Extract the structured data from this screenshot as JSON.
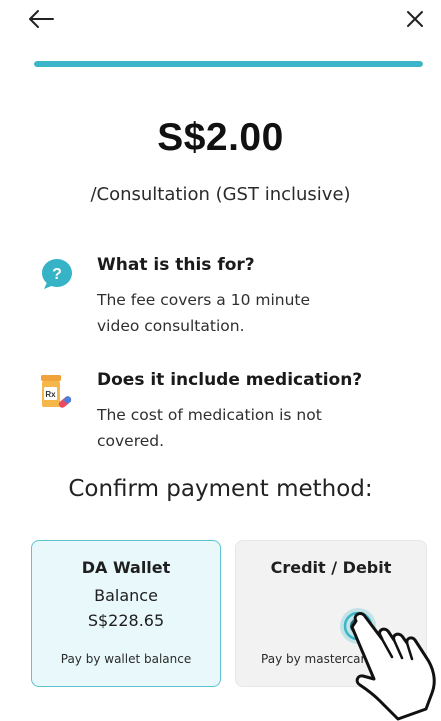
{
  "header": {
    "back_icon": "arrow-left-icon",
    "close_icon": "close-icon",
    "progress_percent": 100,
    "progress_color": "#3bb6c8"
  },
  "fee": {
    "price": "S$2.00",
    "subtitle": "/Consultation (GST inclusive)"
  },
  "info": [
    {
      "icon": "question-bubble-icon",
      "title": "What is this for?",
      "text": "The fee covers a 10 minute video consultation."
    },
    {
      "icon": "medication-bottle-icon",
      "title": "Does it include medication?",
      "text": "The cost of medication is not covered."
    }
  ],
  "payment": {
    "title": "Confirm payment method:",
    "wallet": {
      "title": "DA Wallet",
      "line1": "Balance",
      "line2": "S$228.65",
      "note": "Pay by wallet balance"
    },
    "credit": {
      "title": "Credit / Debit",
      "note": "Pay by mastercard/visa"
    }
  },
  "colors": {
    "accent": "#3bb6c8",
    "selected_card_bg": "#e8f8fb",
    "selected_card_border": "#5ec4d3"
  }
}
